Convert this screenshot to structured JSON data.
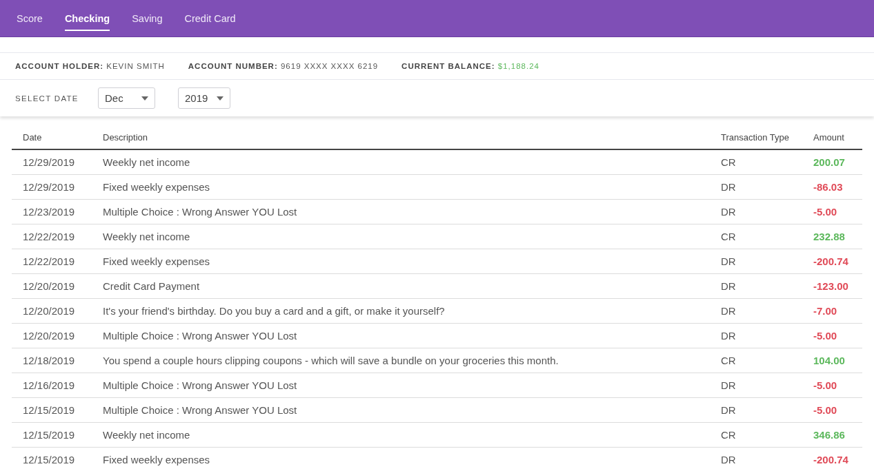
{
  "tabs": [
    {
      "label": "Score",
      "selected": false
    },
    {
      "label": "Checking",
      "selected": true
    },
    {
      "label": "Saving",
      "selected": false
    },
    {
      "label": "Credit Card",
      "selected": false
    }
  ],
  "account": [
    {
      "label": "ACCOUNT HOLDER:",
      "value": "KEVIN SMITH",
      "kind": "plain"
    },
    {
      "label": "ACCOUNT NUMBER:",
      "value": "9619 XXXX XXXX 6219",
      "kind": "plain"
    },
    {
      "label": "CURRENT BALANCE:",
      "value": "$1,188.24",
      "kind": "money"
    }
  ],
  "date_filter": {
    "label": "SELECT DATE",
    "month": "Dec",
    "year": "2019"
  },
  "table": {
    "columns": [
      "Date",
      "Description",
      "Transaction Type",
      "Amount"
    ],
    "rows": [
      {
        "date": "12/29/2019",
        "description": "Weekly net income",
        "type": "CR",
        "amount": "200.07",
        "kind": "credit"
      },
      {
        "date": "12/29/2019",
        "description": "Fixed weekly expenses",
        "type": "DR",
        "amount": "-86.03",
        "kind": "debit"
      },
      {
        "date": "12/23/2019",
        "description": "Multiple Choice : Wrong Answer YOU Lost",
        "type": "DR",
        "amount": "-5.00",
        "kind": "debit"
      },
      {
        "date": "12/22/2019",
        "description": "Weekly net income",
        "type": "CR",
        "amount": "232.88",
        "kind": "credit"
      },
      {
        "date": "12/22/2019",
        "description": "Fixed weekly expenses",
        "type": "DR",
        "amount": "-200.74",
        "kind": "debit"
      },
      {
        "date": "12/20/2019",
        "description": "Credit Card Payment",
        "type": "DR",
        "amount": "-123.00",
        "kind": "debit"
      },
      {
        "date": "12/20/2019",
        "description": "It's your friend's birthday. Do you buy a card and a gift, or make it yourself?",
        "type": "DR",
        "amount": "-7.00",
        "kind": "debit"
      },
      {
        "date": "12/20/2019",
        "description": "Multiple Choice : Wrong Answer YOU Lost",
        "type": "DR",
        "amount": "-5.00",
        "kind": "debit"
      },
      {
        "date": "12/18/2019",
        "description": "You spend a couple hours clipping coupons - which will save a bundle on your groceries this month.",
        "type": "CR",
        "amount": "104.00",
        "kind": "credit"
      },
      {
        "date": "12/16/2019",
        "description": "Multiple Choice : Wrong Answer YOU Lost",
        "type": "DR",
        "amount": "-5.00",
        "kind": "debit"
      },
      {
        "date": "12/15/2019",
        "description": "Multiple Choice : Wrong Answer YOU Lost",
        "type": "DR",
        "amount": "-5.00",
        "kind": "debit"
      },
      {
        "date": "12/15/2019",
        "description": "Weekly net income",
        "type": "CR",
        "amount": "346.86",
        "kind": "credit"
      },
      {
        "date": "12/15/2019",
        "description": "Fixed weekly expenses",
        "type": "DR",
        "amount": "-200.74",
        "kind": "debit"
      }
    ]
  }
}
